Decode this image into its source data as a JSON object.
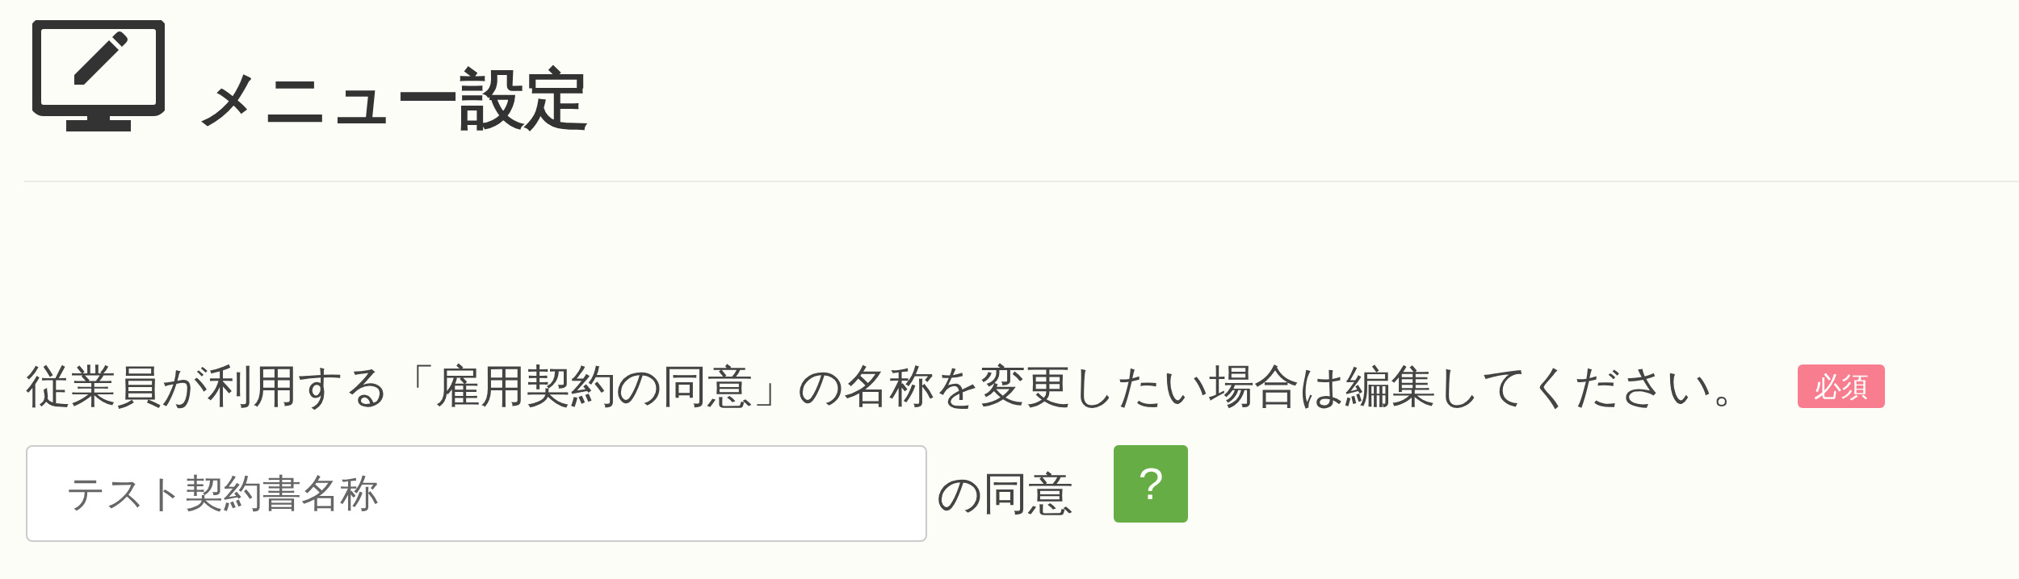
{
  "header": {
    "title": "メニュー設定"
  },
  "form": {
    "description": "従業員が利用する「雇用契約の同意」の名称を変更したい場合は編集してください。",
    "required_badge": "必須",
    "name_field": {
      "value": "テスト契約書名称"
    },
    "suffix": "の同意",
    "help_button": "?"
  }
}
